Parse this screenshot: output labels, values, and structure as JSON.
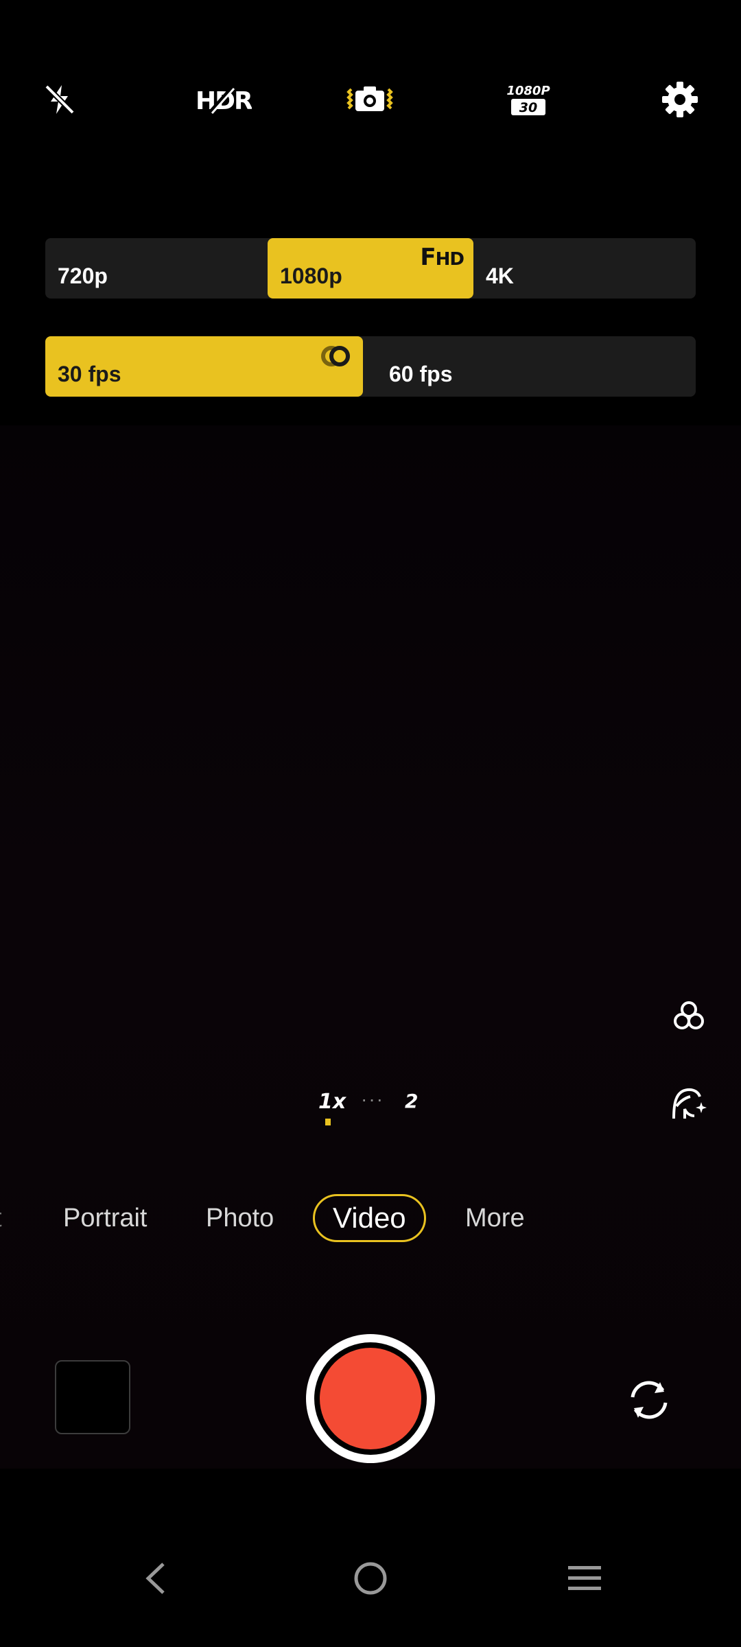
{
  "toolbar": {
    "flash_icon": "flash-off-icon",
    "hdr_label": "HDR",
    "stabilize_icon": "camera-stabilize-icon",
    "video_spec_top": "1080P",
    "video_spec_bottom": "30",
    "settings_icon": "gear-icon"
  },
  "resolution": {
    "options": [
      "720p",
      "1080p",
      "4K"
    ],
    "selected": "1080p",
    "badge_big": "F",
    "badge_small": "HD"
  },
  "fps": {
    "options": [
      "30 fps",
      "60 fps"
    ],
    "selected": "30 fps"
  },
  "side": {
    "filter_icon": "filter-circles-icon",
    "beauty_icon": "beauty-face-icon"
  },
  "zoom": {
    "current": "1x",
    "dots": "···",
    "next": "2"
  },
  "modes": {
    "items": [
      "t",
      "Portrait",
      "Photo",
      "Video",
      "More"
    ],
    "selected": "Video"
  },
  "colors": {
    "accent": "#e9c220",
    "record": "#f44b34"
  }
}
